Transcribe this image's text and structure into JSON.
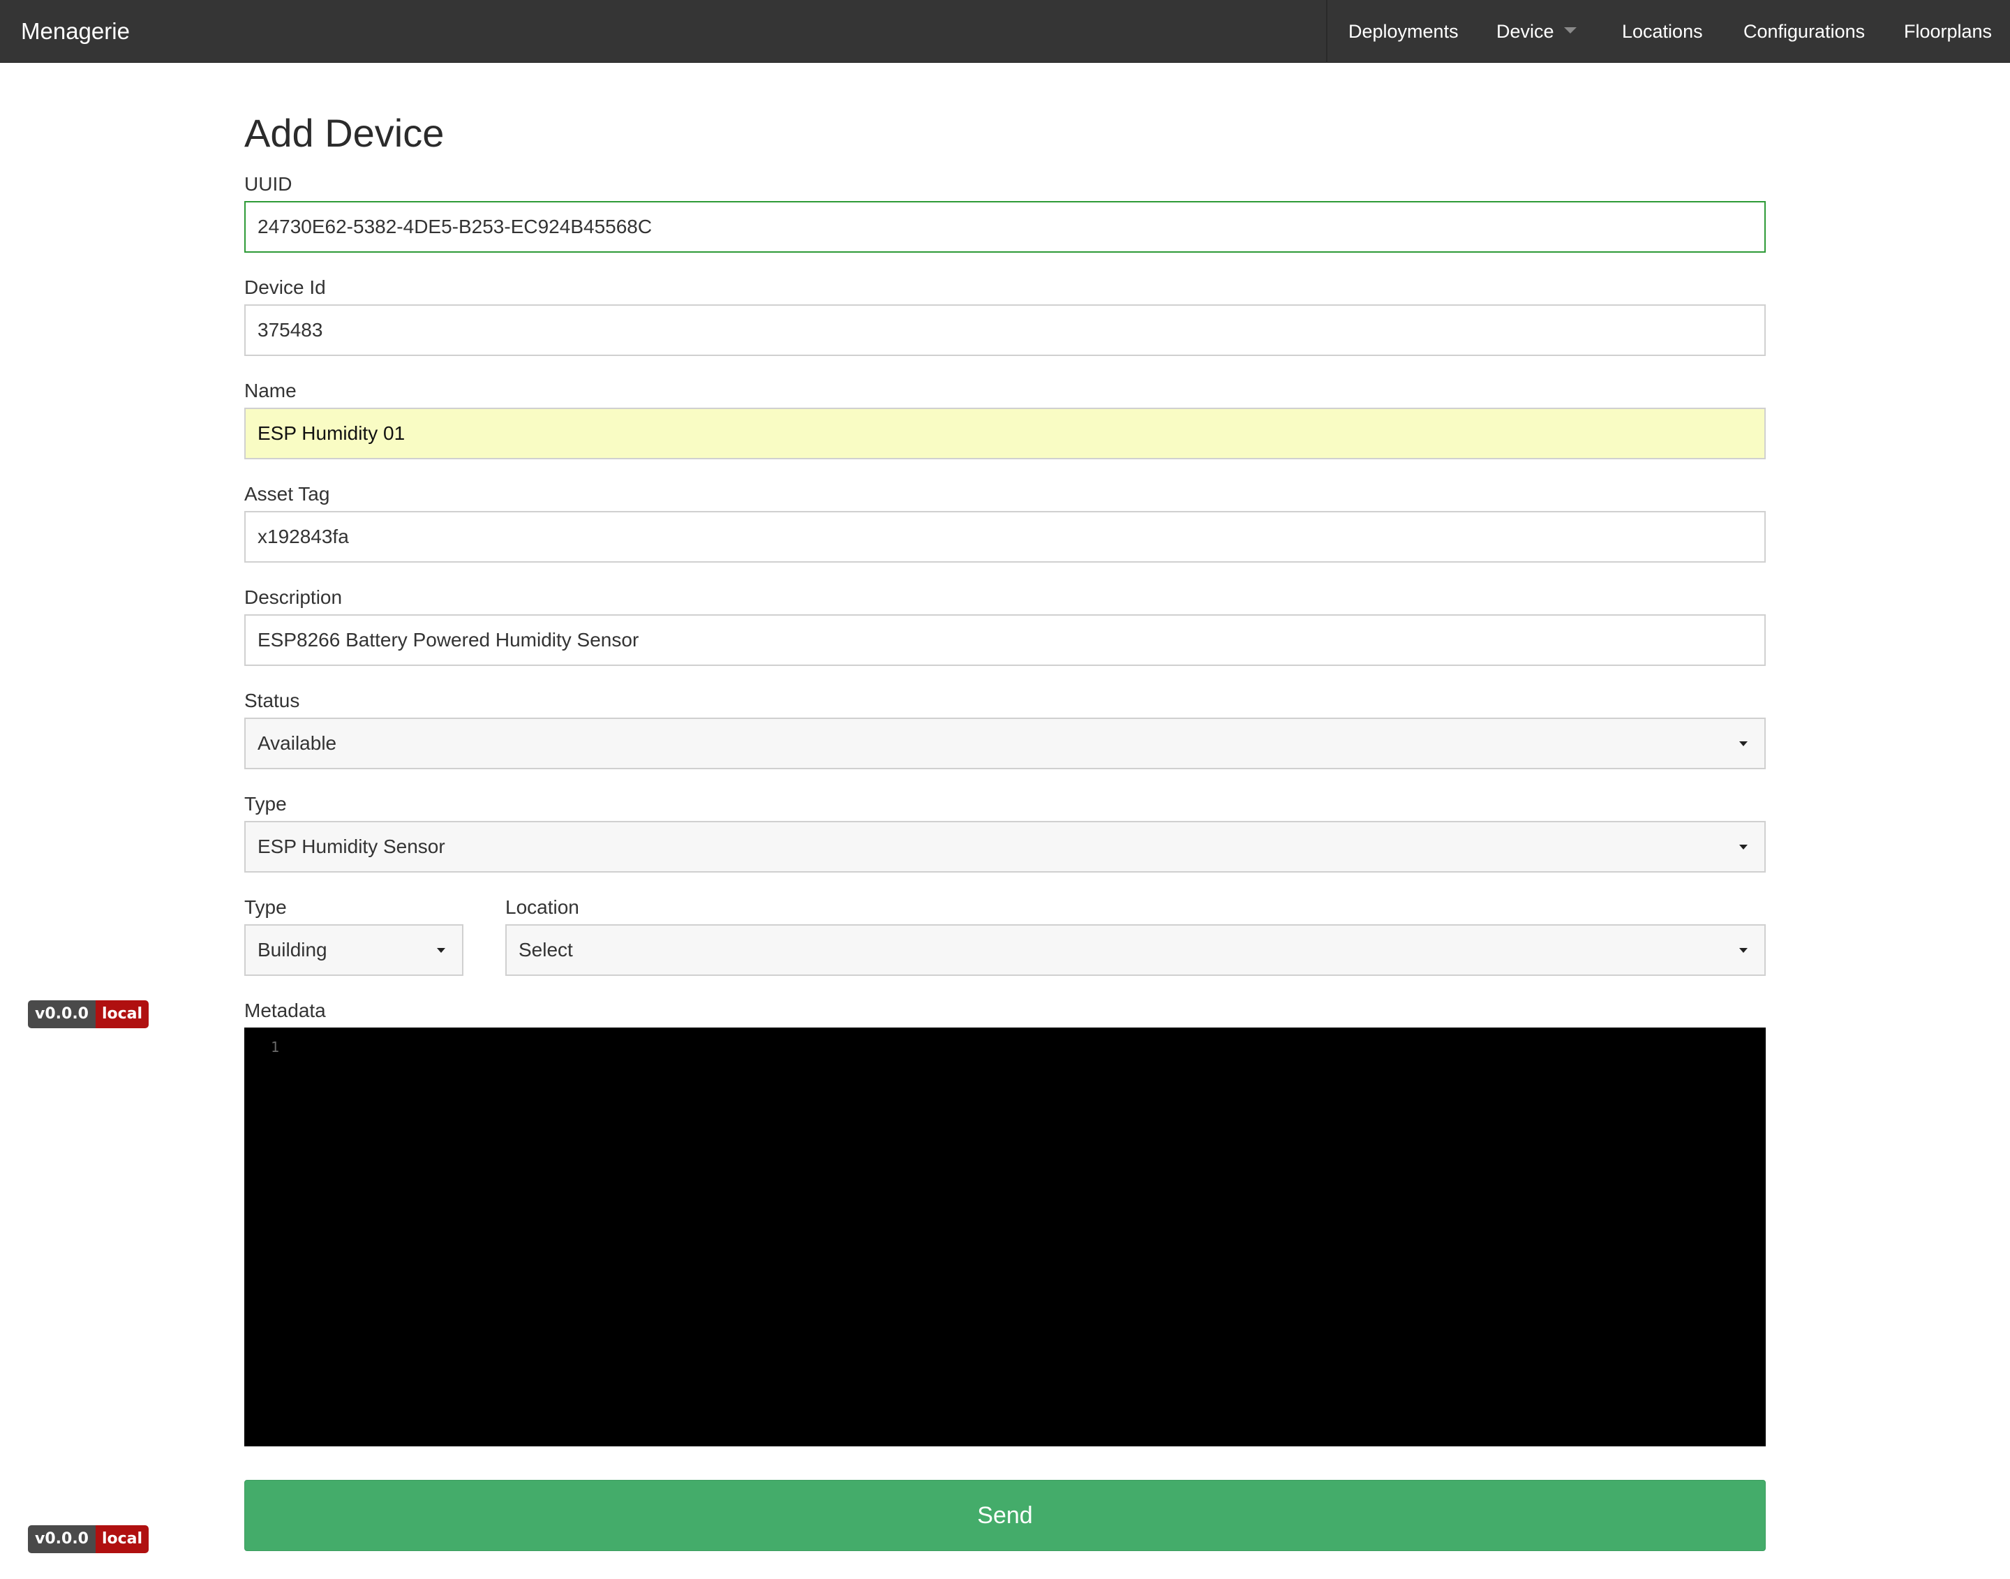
{
  "navbar": {
    "brand": "Menagerie",
    "items": [
      {
        "label": "Deployments"
      },
      {
        "label": "Device"
      },
      {
        "label": "Locations"
      },
      {
        "label": "Configurations"
      },
      {
        "label": "Floorplans"
      }
    ]
  },
  "form": {
    "title": "Add Device",
    "uuid": {
      "label": "UUID",
      "value": "24730E62-5382-4DE5-B253-EC924B45568C"
    },
    "device_id": {
      "label": "Device Id",
      "value": "375483"
    },
    "name": {
      "label": "Name",
      "value": "ESP Humidity 01"
    },
    "asset_tag": {
      "label": "Asset Tag",
      "value": "x192843fa"
    },
    "description": {
      "label": "Description",
      "value": "ESP8266 Battery Powered Humidity Sensor"
    },
    "status": {
      "label": "Status",
      "selected": "Available"
    },
    "type": {
      "label": "Type",
      "selected": "ESP Humidity Sensor"
    },
    "location_type": {
      "label": "Type",
      "selected": "Building"
    },
    "location": {
      "label": "Location",
      "selected": "Select"
    },
    "metadata": {
      "label": "Metadata",
      "line_number": "1"
    },
    "send_label": "Send"
  },
  "badges": [
    {
      "version": "v0.0.0",
      "env": "local"
    },
    {
      "version": "v0.0.0",
      "env": "local"
    }
  ],
  "colors": {
    "navbar_bg": "#353535",
    "valid_border": "#2e9a37",
    "autofill_bg": "#f9fcc4",
    "send_button": "#44ac6a",
    "badge_env": "#b01010"
  }
}
